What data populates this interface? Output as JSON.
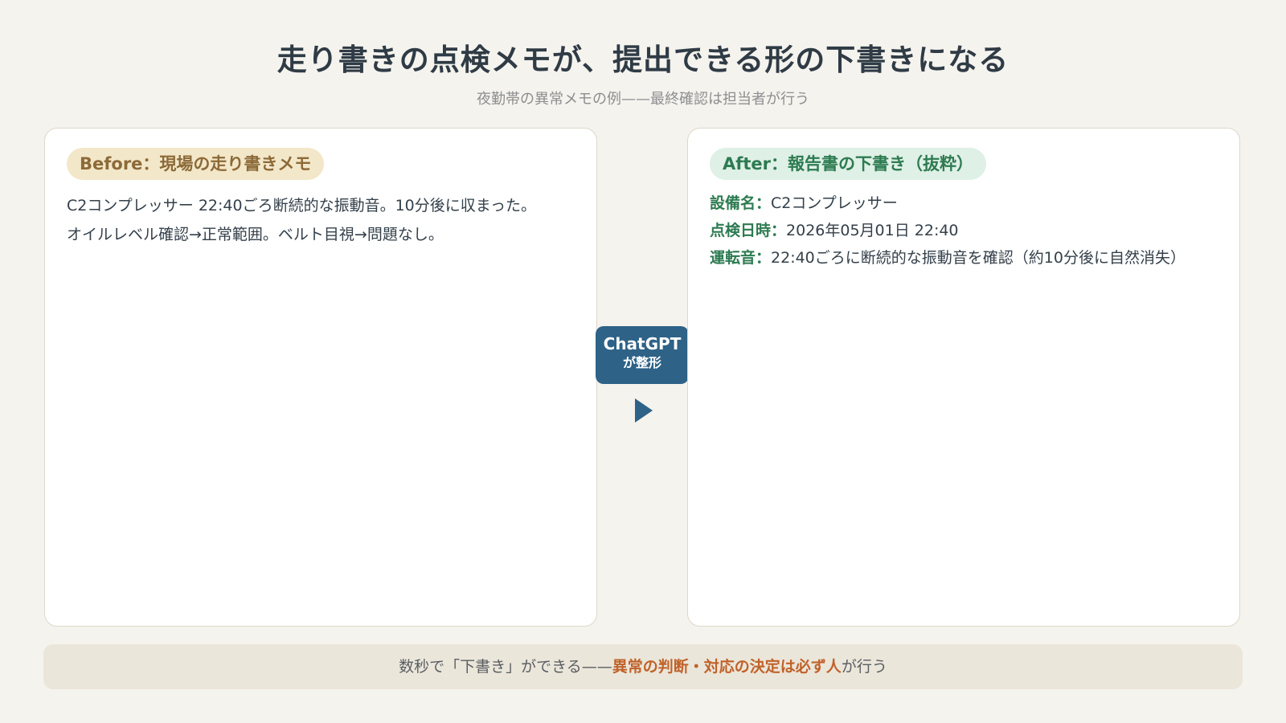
{
  "header": {
    "title": "走り書きの点検メモが、提出できる形の下書きになる",
    "subtitle": "夜勤帯の異常メモの例——最終確認は担当者が行う"
  },
  "before": {
    "label": "Before：現場の走り書きメモ",
    "lines": [
      "C2コンプレッサー 22:40ごろ断続的な振動音。10分後に収まった。",
      "オイルレベル確認→正常範囲。ベルト目視→問題なし。"
    ]
  },
  "after": {
    "label": "After：報告書の下書き（抜粋）",
    "fields": [
      {
        "label": "設備名：",
        "value": "C2コンプレッサー"
      },
      {
        "label": "点検日時：",
        "value": "2026年05月01日 22:40"
      },
      {
        "label": "運転音：",
        "value": "22:40ごろに断続的な振動音を確認（約10分後に自然消失）"
      }
    ]
  },
  "transform": {
    "line1": "ChatGPT",
    "line2": "が整形"
  },
  "footer": {
    "text_before": "数秒で「下書き」ができる——",
    "highlight": "異常の判断・対応の決定は必ず人",
    "text_after": "が行う"
  },
  "colors": {
    "background": "#f5f3ee",
    "before_accent": "#8c6a38",
    "after_accent": "#2d7b51",
    "badge": "#2e6287",
    "highlight": "#c0622a"
  }
}
